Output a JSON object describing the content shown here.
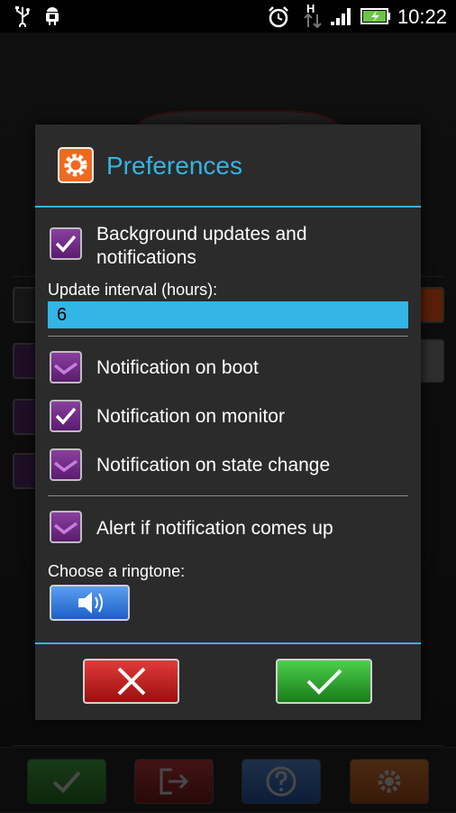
{
  "status_bar": {
    "time": "10:22",
    "icons": [
      "usb-icon",
      "android-debug-icon",
      "alarm-icon",
      "hspa-data-icon",
      "signal-icon",
      "battery-charging-icon"
    ],
    "network_label": "H"
  },
  "dialog": {
    "title": "Preferences",
    "title_icon": "gear-icon",
    "background_updates": {
      "label": "Background updates and notifications",
      "checked": true
    },
    "update_interval": {
      "label": "Update interval (hours):",
      "value": "6"
    },
    "notification_boot": {
      "label": "Notification on boot",
      "checked": true
    },
    "notification_monitor": {
      "label": "Notification on monitor",
      "checked": true
    },
    "notification_state_change": {
      "label": "Notification on state change",
      "checked": true
    },
    "alert_notification": {
      "label": "Alert if notification comes up",
      "checked": true
    },
    "ringtone": {
      "label": "Choose a ringtone:",
      "icon": "speaker-icon"
    },
    "cancel_icon": "close-icon",
    "ok_icon": "check-icon"
  },
  "bottom_bar": {
    "buttons": [
      "check-icon",
      "exit-icon",
      "help-icon",
      "gear-icon"
    ]
  },
  "colors": {
    "accent": "#33b5e5",
    "checkbox": "#7a2f90",
    "cancel": "#c41e1e",
    "ok": "#2e9e2e",
    "ringtone": "#2f6fd6"
  }
}
